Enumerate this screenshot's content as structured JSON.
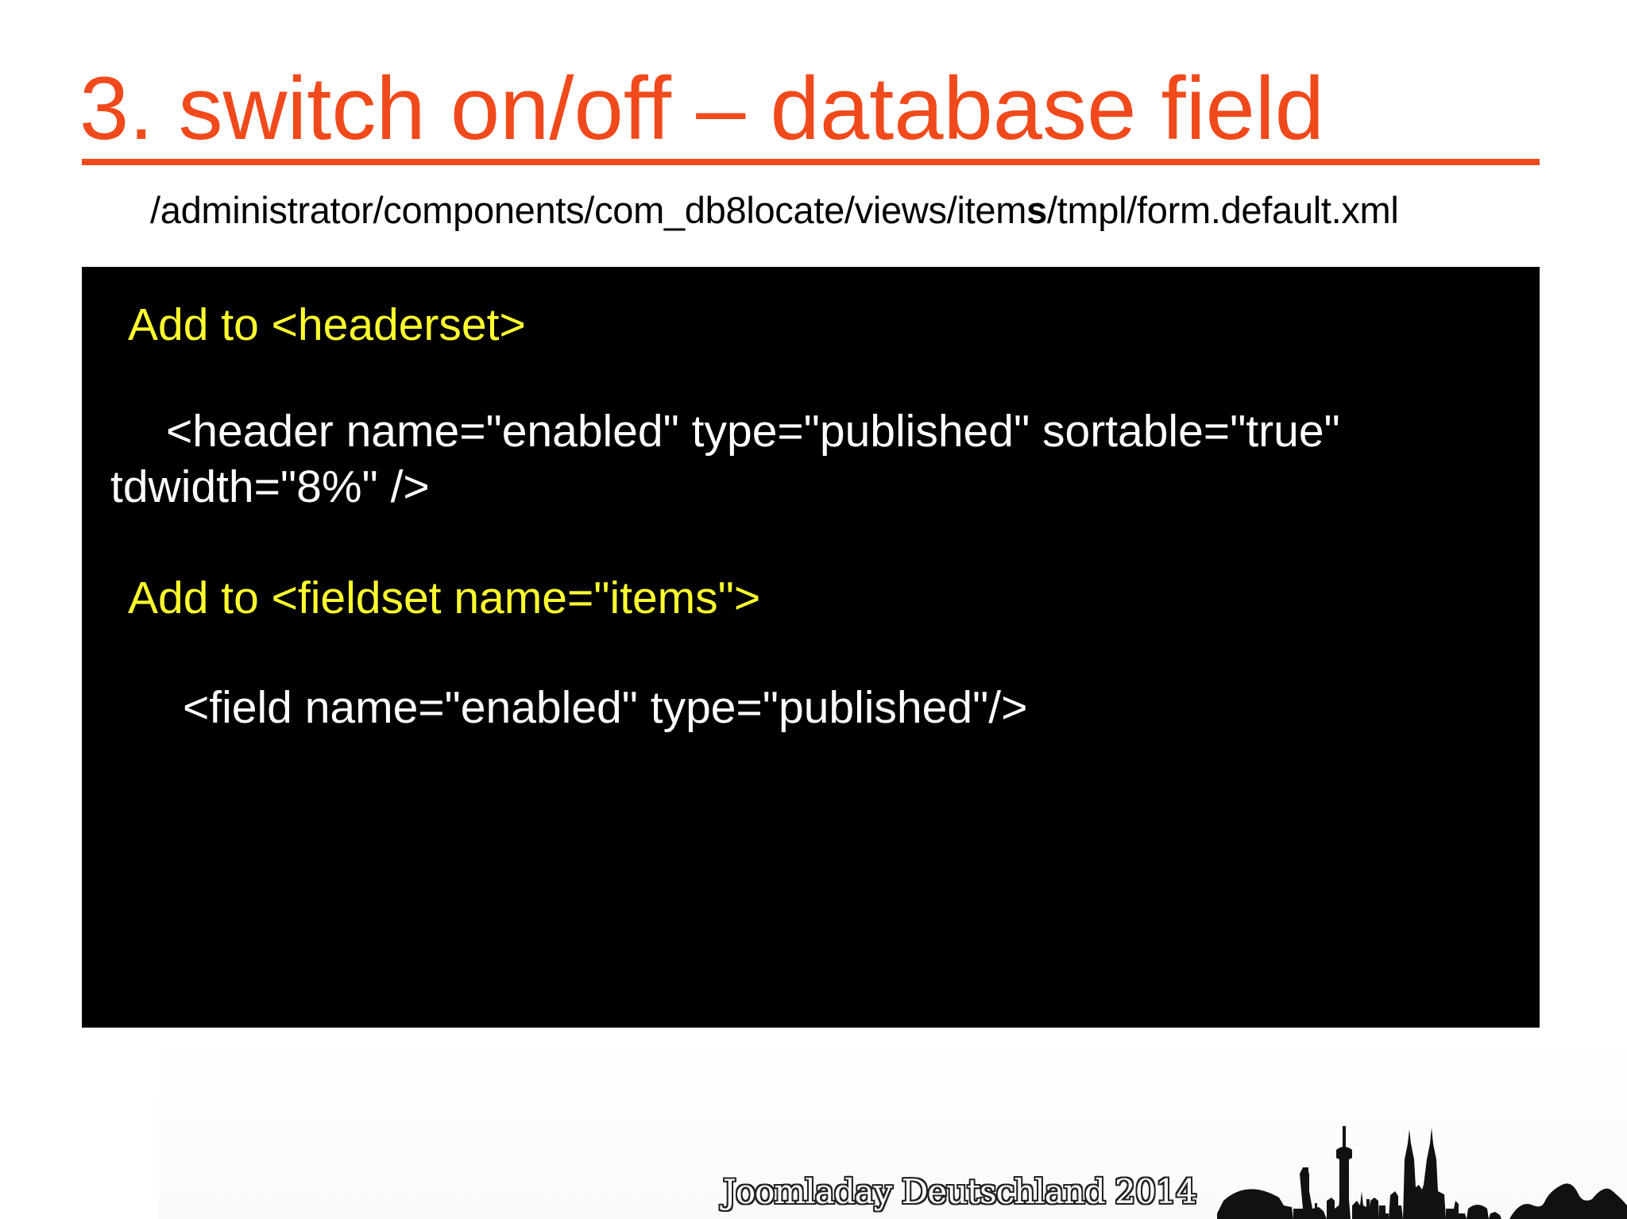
{
  "slide": {
    "title": "3. switch on/off – database field",
    "file_path": {
      "prefix": "/administrator/components/com_db8locate/views/item",
      "bold": "s",
      "suffix": "/tmpl/form.default.xml"
    },
    "code": {
      "headerset_label": "Add to <headerset>",
      "header_line_1": "<header name=\"enabled\" type=\"published\" sortable=\"true\"",
      "header_line_2": "tdwidth=\"8%\" />",
      "fieldset_label": "Add to <fieldset name=\"items\">",
      "field_line": "<field name=\"enabled\" type=\"published\"/>"
    },
    "footer": "Joomladay Deutschland 2014"
  },
  "colors": {
    "title": "#f04a1c",
    "code_background": "#000000",
    "code_label": "#ffff2e",
    "code_text": "#ffffff"
  }
}
